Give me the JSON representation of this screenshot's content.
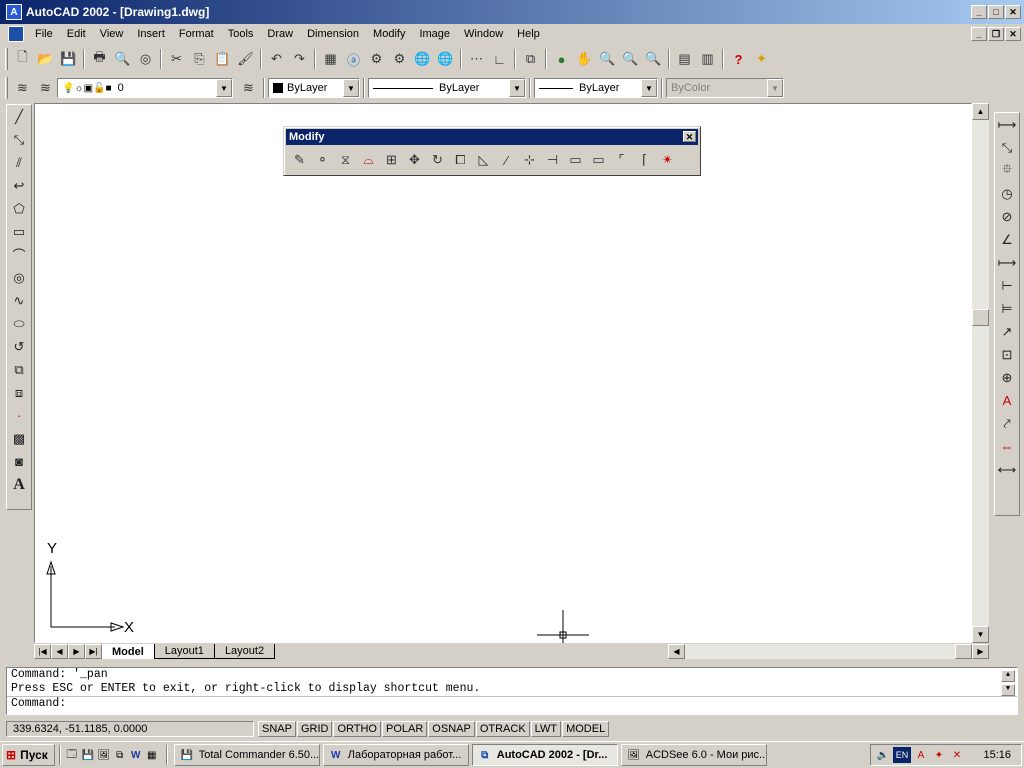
{
  "window": {
    "title": "AutoCAD 2002 - [Drawing1.dwg]"
  },
  "menu": [
    "File",
    "Edit",
    "View",
    "Insert",
    "Format",
    "Tools",
    "Draw",
    "Dimension",
    "Modify",
    "Image",
    "Window",
    "Help"
  ],
  "layer_combo": {
    "value": "0"
  },
  "color_combo": {
    "value": "ByLayer"
  },
  "linetype_combo": {
    "value": "ByLayer"
  },
  "lineweight_combo": {
    "value": "ByLayer"
  },
  "plotstyle_combo": {
    "value": "ByColor"
  },
  "modify_toolbar": {
    "title": "Modify"
  },
  "ucs": {
    "x_label": "X",
    "y_label": "Y"
  },
  "tabs": [
    "Model",
    "Layout1",
    "Layout2"
  ],
  "command_history": [
    "Command: '_pan",
    "Press ESC or ENTER to exit, or right-click to display shortcut menu."
  ],
  "command_prompt": "Command:",
  "status": {
    "coords": "339.6324, -51.1185, 0.0000",
    "buttons": [
      "SNAP",
      "GRID",
      "ORTHO",
      "POLAR",
      "OSNAP",
      "OTRACK",
      "LWT",
      "MODEL"
    ]
  },
  "taskbar": {
    "start_label": "Пуск",
    "tasks": [
      "Total Commander 6.50...",
      "Лабораторная работ...",
      "AutoCAD 2002 - [Dr...",
      "ACDSee 6.0 - Мои рис..."
    ],
    "lang": "EN",
    "clock": "15:16"
  }
}
